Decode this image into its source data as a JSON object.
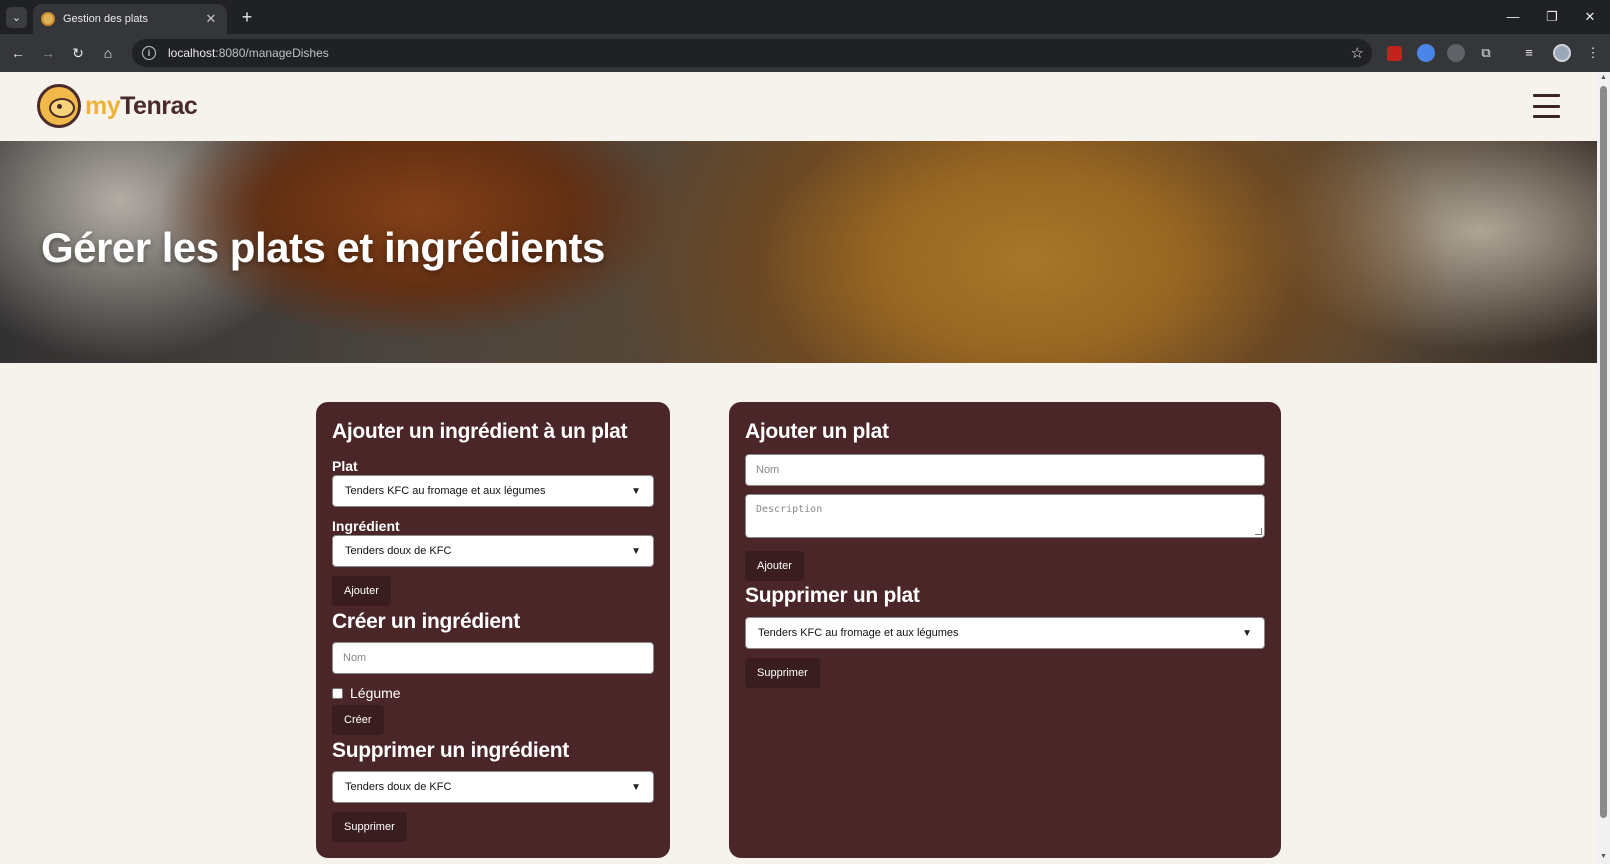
{
  "browser": {
    "tab_title": "Gestion des plats",
    "url_host": "localhost",
    "url_rest": ":8080/manageDishes"
  },
  "site": {
    "logo_my": "my",
    "logo_name": "Tenrac",
    "hero_title": "Gérer les plats et ingrédients"
  },
  "add_ingredient_to_dish": {
    "title": "Ajouter un ingrédient à un plat",
    "dish_label": "Plat",
    "dish_selected": "Tenders KFC au fromage et aux légumes",
    "ingredient_label": "Ingrédient",
    "ingredient_selected": "Tenders doux de KFC",
    "submit_label": "Ajouter"
  },
  "create_ingredient": {
    "title": "Créer un ingrédient",
    "name_placeholder": "Nom",
    "vegetable_label": "Légume",
    "vegetable_checked": false,
    "submit_label": "Créer"
  },
  "delete_ingredient": {
    "title": "Supprimer un ingrédient",
    "selected": "Tenders doux de KFC",
    "submit_label": "Supprimer"
  },
  "add_dish": {
    "title": "Ajouter un plat",
    "name_placeholder": "Nom",
    "description_placeholder": "Description",
    "submit_label": "Ajouter"
  },
  "delete_dish": {
    "title": "Supprimer un plat",
    "selected": "Tenders KFC au fromage et aux légumes",
    "submit_label": "Supprimer"
  },
  "colors": {
    "panel": "#4a2629",
    "button": "#3a1d1f",
    "page_bg": "#f6f3ec",
    "logo_accent": "#f0b138"
  }
}
